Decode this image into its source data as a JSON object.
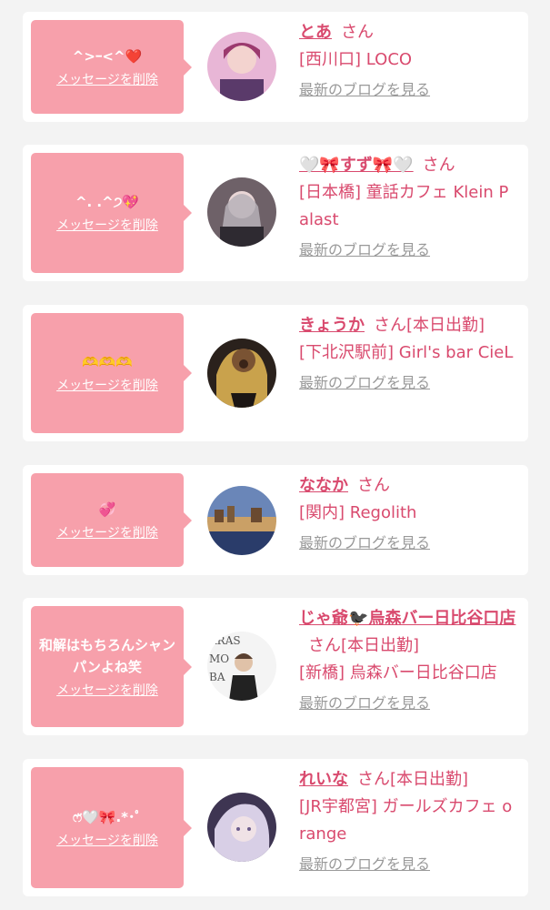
{
  "entries": [
    {
      "message": "^>ｰ<^❤️",
      "delete_label": "メッセージを削除",
      "name": "とあ",
      "suffix": "さん",
      "shop": "[西川口] LOCO",
      "blog_label": "最新のブログを見る",
      "avatar_color": "#c46a9c"
    },
    {
      "message": "^. .^੭💖",
      "delete_label": "メッセージを削除",
      "name": "🤍🎀すず🎀🤍",
      "suffix": "さん",
      "shop": "[日本橋] 童話カフェ Klein Palast",
      "blog_label": "最新のブログを見る",
      "avatar_color": "#8a7f86"
    },
    {
      "message": "🫶🫶🫶",
      "delete_label": "メッセージを削除",
      "name": "きょうか",
      "suffix": "さん[本日出勤]",
      "shop": "[下北沢駅前] Girl's bar CieL",
      "blog_label": "最新のブログを見る",
      "avatar_color": "#3c2e24"
    },
    {
      "message": "💞",
      "delete_label": "メッセージを削除",
      "name": "ななか",
      "suffix": "さん",
      "shop": "[関内] Regolith",
      "blog_label": "最新のブログを見る",
      "avatar_color": "#3f5f95"
    },
    {
      "message": "和解はもちろんシャンパンよね笑",
      "delete_label": "メッセージを削除",
      "name": "じゃ爺🐦‍⬛烏森バー日比谷口店",
      "suffix": "さん[本日出勤]",
      "shop": "[新橋] 烏森バー日比谷口店",
      "blog_label": "最新のブログを見る",
      "avatar_color": "#f4f4f4"
    },
    {
      "message": "ෆ̈🤍🎀.*･ﾟ",
      "delete_label": "メッセージを削除",
      "name": "れいな",
      "suffix": "さん[本日出勤]",
      "shop": "[JR宇都宮] ガールズカフェ orange",
      "blog_label": "最新のブログを見る",
      "avatar_color": "#b6a3c8"
    }
  ]
}
